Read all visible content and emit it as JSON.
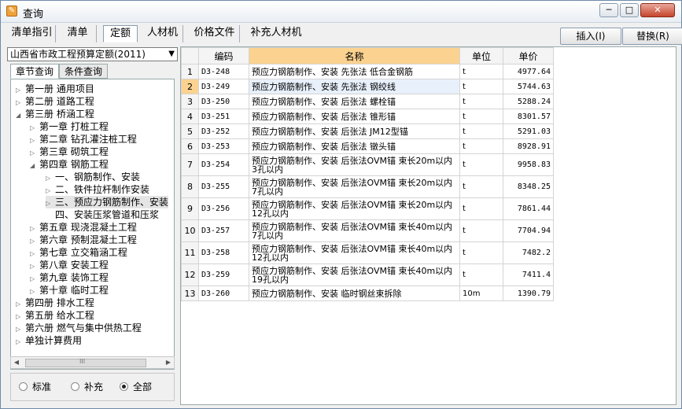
{
  "window": {
    "title": "查询",
    "icon": "app-icon"
  },
  "tabs": [
    {
      "label": "清单指引"
    },
    {
      "label": "清单"
    },
    {
      "label": "定额"
    },
    {
      "label": "人材机"
    },
    {
      "label": "价格文件"
    },
    {
      "label": "补充人材机"
    }
  ],
  "actions": {
    "insert": "插入(I)",
    "replace": "替换(R)"
  },
  "left": {
    "quota_select": "山西省市政工程预算定额(2011)",
    "tabs": [
      {
        "label": "章节查询"
      },
      {
        "label": "条件查询"
      }
    ],
    "tree": [
      {
        "label": "第一册 通用项目"
      },
      {
        "label": "第二册 道路工程"
      },
      {
        "label": "第三册 桥涵工程"
      },
      {
        "label": "第一章 打桩工程"
      },
      {
        "label": "第二章 钻孔灌注桩工程"
      },
      {
        "label": "第三章 砌筑工程"
      },
      {
        "label": "第四章 钢筋工程"
      },
      {
        "label": "一、钢筋制作、安装"
      },
      {
        "label": "二、铁件拉杆制作安装"
      },
      {
        "label": "三、预应力钢筋制作、安装"
      },
      {
        "label": "四、安装压浆管道和压浆"
      },
      {
        "label": "第五章 现浇混凝土工程"
      },
      {
        "label": "第六章 预制混凝土工程"
      },
      {
        "label": "第七章 立交箱涵工程"
      },
      {
        "label": "第八章 安装工程"
      },
      {
        "label": "第九章 装饰工程"
      },
      {
        "label": "第十章 临时工程"
      },
      {
        "label": "第四册 排水工程"
      },
      {
        "label": "第五册 给水工程"
      },
      {
        "label": "第六册 燃气与集中供热工程"
      },
      {
        "label": "单独计算费用"
      }
    ],
    "radios": [
      {
        "label": "标准",
        "checked": false
      },
      {
        "label": "补充",
        "checked": false
      },
      {
        "label": "全部",
        "checked": true
      }
    ],
    "scroll_glyph": "III"
  },
  "table": {
    "headers": {
      "code": "编码",
      "name": "名称",
      "unit": "单位",
      "price": "单价"
    },
    "rows": [
      {
        "idx": "1",
        "code": "D3-248",
        "name": "预应力钢筋制作、安装 先张法 低合金钢筋",
        "unit": "t",
        "price": "4977.64"
      },
      {
        "idx": "2",
        "code": "D3-249",
        "name": "预应力钢筋制作、安装 先张法 钢绞线",
        "unit": "t",
        "price": "5744.63"
      },
      {
        "idx": "3",
        "code": "D3-250",
        "name": "预应力钢筋制作、安装 后张法 螺栓锚",
        "unit": "t",
        "price": "5288.24"
      },
      {
        "idx": "4",
        "code": "D3-251",
        "name": "预应力钢筋制作、安装 后张法 锥形锚",
        "unit": "t",
        "price": "8301.57"
      },
      {
        "idx": "5",
        "code": "D3-252",
        "name": "预应力钢筋制作、安装 后张法 JM12型锚",
        "unit": "t",
        "price": "5291.03"
      },
      {
        "idx": "6",
        "code": "D3-253",
        "name": "预应力钢筋制作、安装 后张法 镦头锚",
        "unit": "t",
        "price": "8928.91"
      },
      {
        "idx": "7",
        "code": "D3-254",
        "name": "预应力钢筋制作、安装 后张法OVM锚 束长20m以内 3孔以内",
        "unit": "t",
        "price": "9958.83"
      },
      {
        "idx": "8",
        "code": "D3-255",
        "name": "预应力钢筋制作、安装 后张法OVM锚 束长20m以内 7孔以内",
        "unit": "t",
        "price": "8348.25"
      },
      {
        "idx": "9",
        "code": "D3-256",
        "name": "预应力钢筋制作、安装 后张法OVM锚 束长20m以内 12孔以内",
        "unit": "t",
        "price": "7861.44"
      },
      {
        "idx": "10",
        "code": "D3-257",
        "name": "预应力钢筋制作、安装 后张法OVM锚 束长40m以内 7孔以内",
        "unit": "t",
        "price": "7704.94"
      },
      {
        "idx": "11",
        "code": "D3-258",
        "name": "预应力钢筋制作、安装 后张法OVM锚 束长40m以内 12孔以内",
        "unit": "t",
        "price": "7482.2"
      },
      {
        "idx": "12",
        "code": "D3-259",
        "name": "预应力钢筋制作、安装 后张法OVM锚 束长40m以内 19孔以内",
        "unit": "t",
        "price": "7411.4"
      },
      {
        "idx": "13",
        "code": "D3-260",
        "name": "预应力钢筋制作、安装 临时钢丝束拆除",
        "unit": "10m",
        "price": "1390.79"
      }
    ]
  },
  "colors": {
    "header_selected": "#fbd28f",
    "row_selected": "#e8f0fb"
  }
}
